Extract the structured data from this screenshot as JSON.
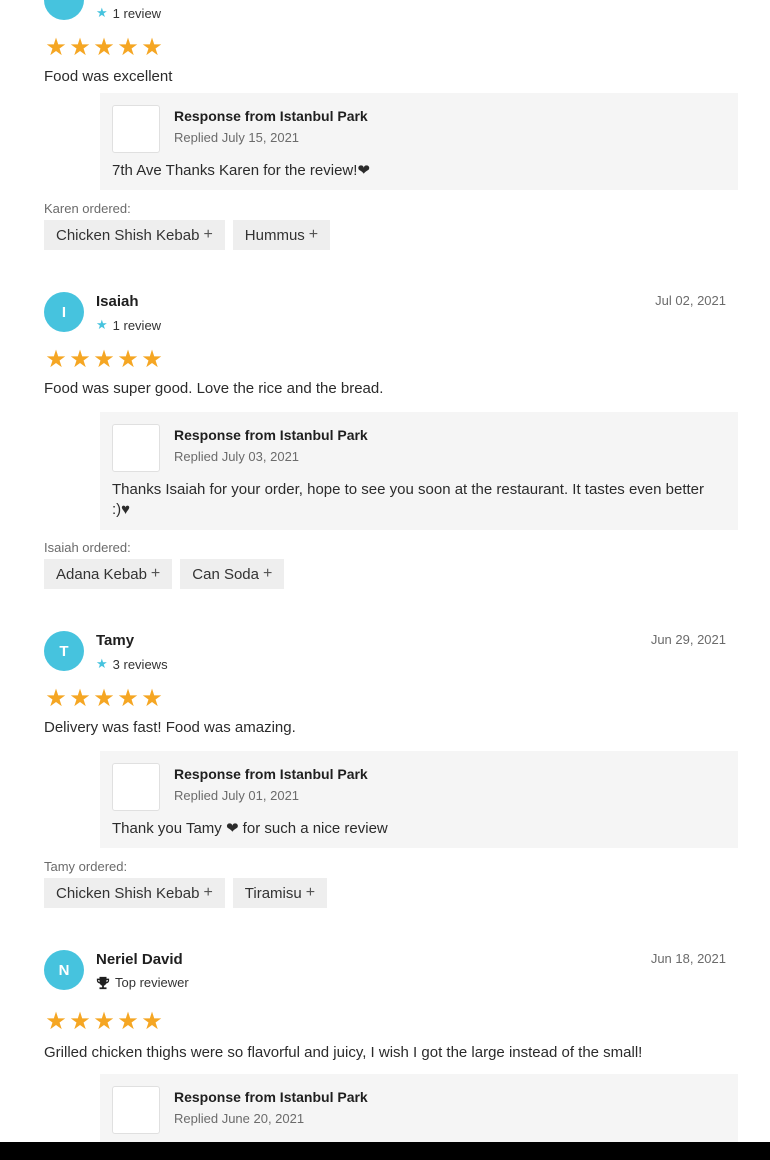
{
  "reviews": [
    {
      "avatar_letter": "",
      "name": "",
      "date": "",
      "meta_text": "1 review",
      "meta_icon": "star-icon",
      "rating": 5,
      "text": "Food was excellent",
      "response": {
        "title": "Response from Istanbul Park",
        "replied": "Replied July 15, 2021",
        "text": "7th Ave Thanks Karen for the review!❤"
      },
      "ordered_label": "Karen ordered:",
      "items": [
        "Chicken Shish Kebab",
        "Hummus"
      ]
    },
    {
      "avatar_letter": "I",
      "name": "Isaiah",
      "date": "Jul 02, 2021",
      "meta_text": "1 review",
      "meta_icon": "star-icon",
      "rating": 5,
      "text": "Food was super good. Love the rice and the bread.",
      "response": {
        "title": "Response from Istanbul Park",
        "replied": "Replied July 03, 2021",
        "text": "Thanks Isaiah for your order, hope to see you soon at the restaurant. It tastes even better :)♥"
      },
      "ordered_label": "Isaiah ordered:",
      "items": [
        "Adana Kebab",
        "Can Soda"
      ]
    },
    {
      "avatar_letter": "T",
      "name": "Tamy",
      "date": "Jun 29, 2021",
      "meta_text": "3 reviews",
      "meta_icon": "star-icon",
      "rating": 5,
      "text": "Delivery was fast! Food was amazing.",
      "response": {
        "title": "Response from Istanbul Park",
        "replied": "Replied July 01, 2021",
        "text": "Thank you Tamy ❤ for such a nice review"
      },
      "ordered_label": "Tamy ordered:",
      "items": [
        "Chicken Shish Kebab",
        "Tiramisu"
      ]
    },
    {
      "avatar_letter": "N",
      "name": "Neriel David",
      "date": "Jun 18, 2021",
      "meta_text": "Top reviewer",
      "meta_icon": "trophy-icon",
      "rating": 5,
      "text": "Grilled chicken thighs were so flavorful and juicy, I wish I got the large instead of the small!",
      "response": {
        "title": "Response from Istanbul Park",
        "replied": "Replied June 20, 2021",
        "text": ""
      },
      "ordered_label": "",
      "items": []
    }
  ],
  "colors": {
    "avatar": "#46c3de",
    "star": "#f5a623",
    "response_bg": "#f5f5f5",
    "chip_bg": "#eeeeee"
  },
  "icons": {
    "plus": "+",
    "star_glyph": "★"
  }
}
